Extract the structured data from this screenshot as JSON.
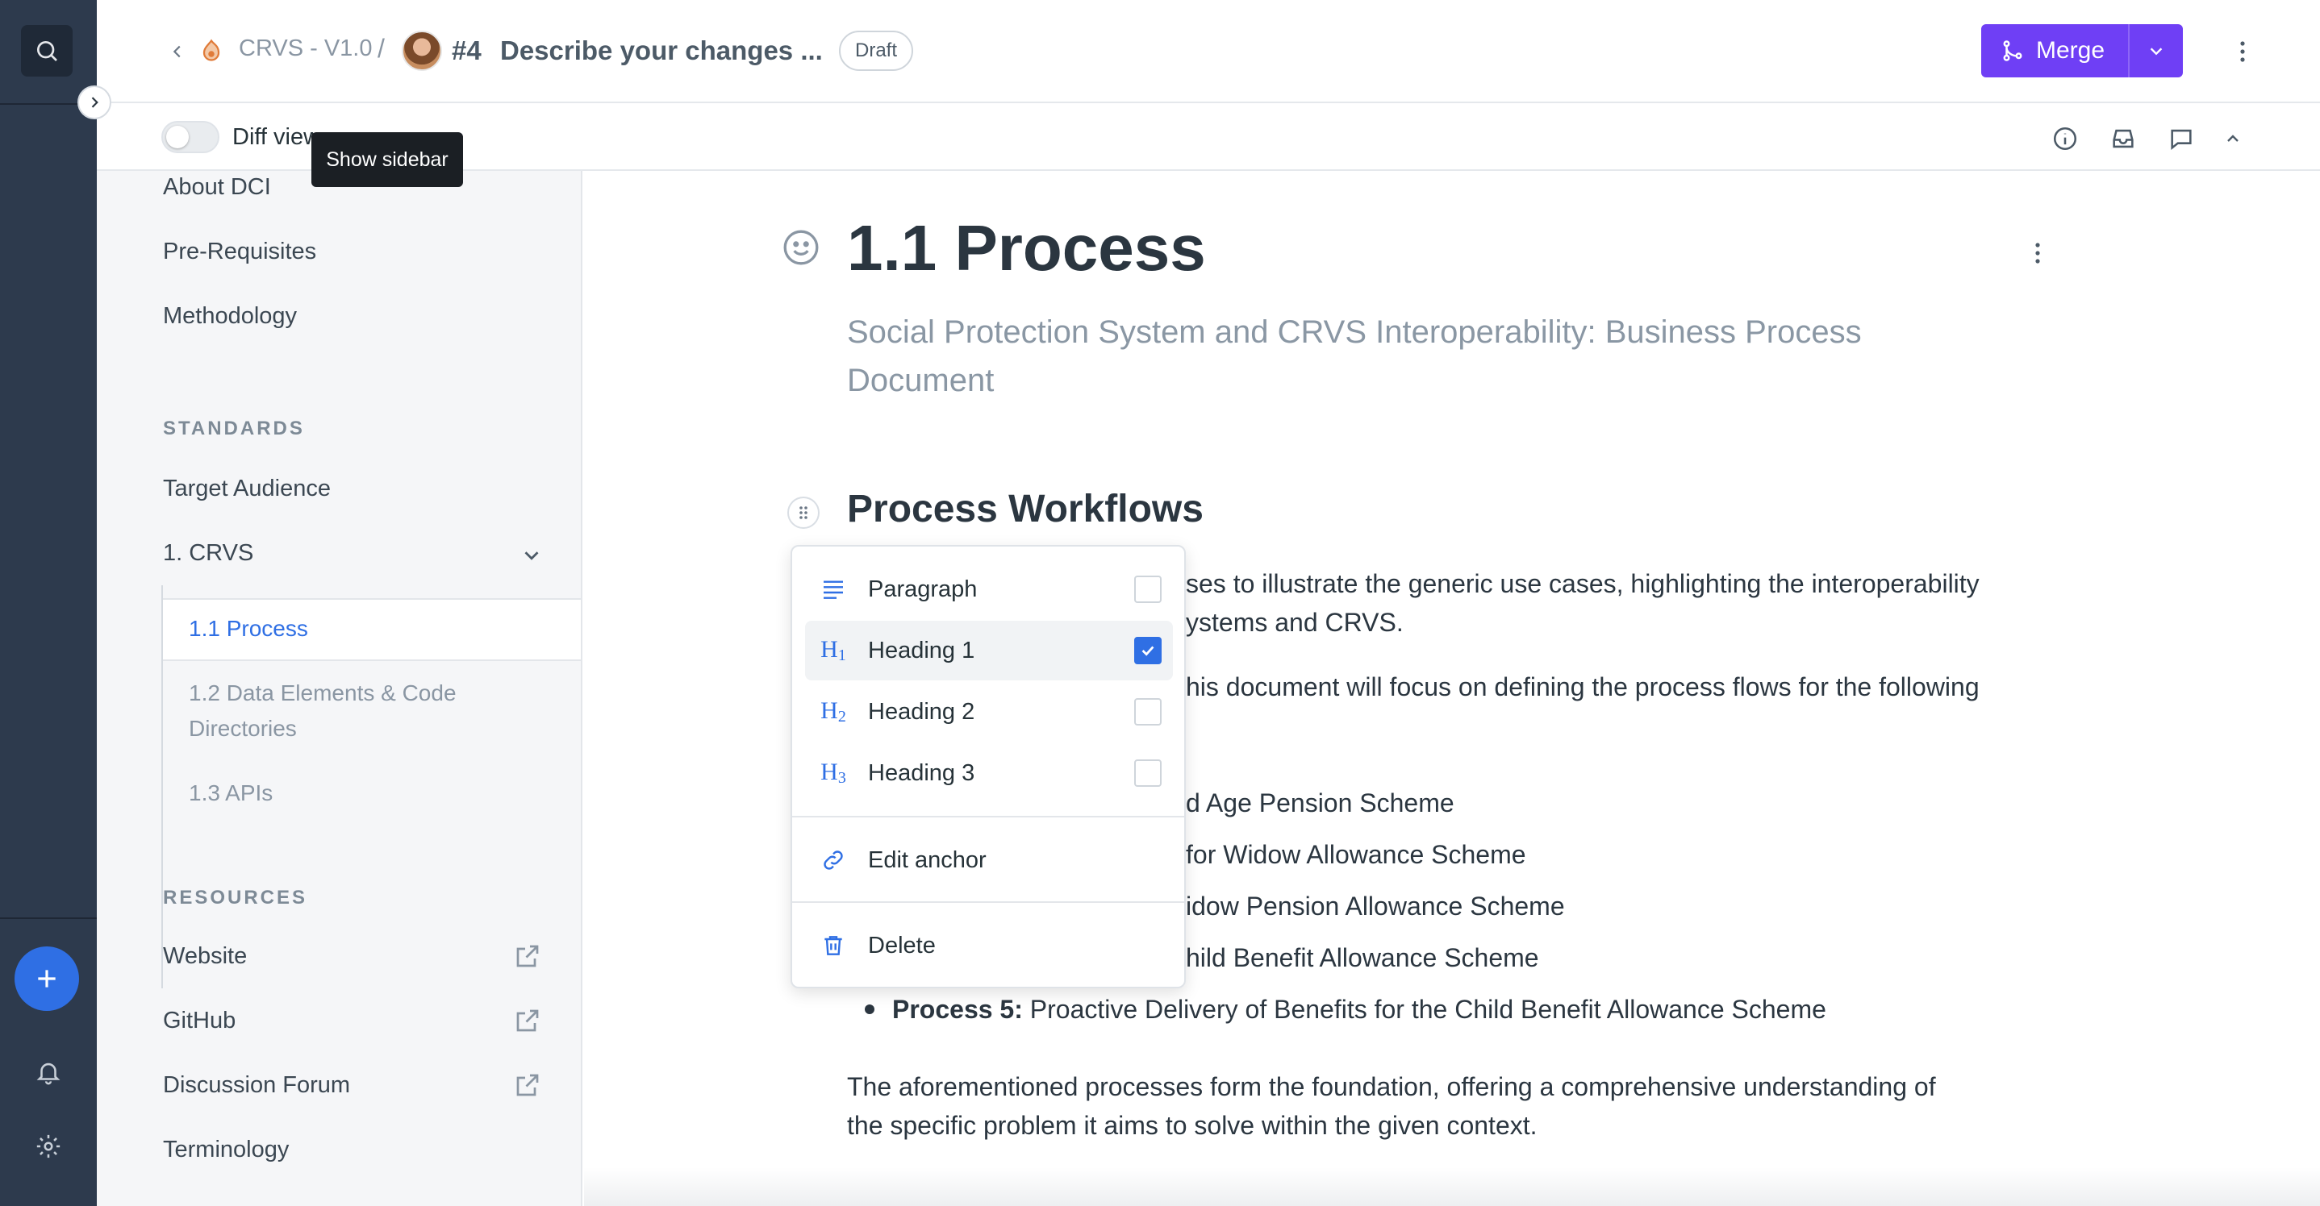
{
  "header": {
    "project": "CRVS - V1.0",
    "separator": "/",
    "change_request_number": "#4",
    "change_request_title": "Describe your changes ...",
    "status_badge": "Draft",
    "merge_label": "Merge",
    "accent_color": "#6f3ff5"
  },
  "toolbar": {
    "diff_view_label": "Diff view",
    "diff_view_enabled": false
  },
  "tooltip": {
    "text": "Show sidebar"
  },
  "sidebar": {
    "top_items": [
      "About DCI",
      "Pre-Requisites",
      "Methodology"
    ],
    "standards_heading": "STANDARDS",
    "standards_items": [
      "Target Audience",
      "1. CRVS"
    ],
    "crvs_children": [
      "1.1 Process",
      "1.2 Data Elements & Code",
      "Directories",
      "1.3 APIs"
    ],
    "resources_heading": "RESOURCES",
    "resources_items": [
      "Website",
      "GitHub",
      "Discussion Forum",
      "Terminology"
    ]
  },
  "document": {
    "title": "1.1 Process",
    "subtitle_line1": "Social Protection System and CRVS Interoperability: Business Process",
    "subtitle_line2": "Document",
    "heading": "Process Workflows",
    "para1_line1": "ses to illustrate the generic use cases, highlighting the interoperability",
    "para1_line2": "ystems and CRVS.",
    "para2_line1": "his document will focus on defining the process flows for the following",
    "list": [
      "d Age Pension Scheme",
      "for Widow Allowance Scheme",
      "idow Pension Allowance Scheme",
      "hild Benefit Allowance Scheme"
    ],
    "process5_label": "Process 5:",
    "process5_text": "Proactive Delivery of Benefits for the Child Benefit Allowance Scheme",
    "closing_line1": "The aforementioned processes form the foundation, offering a comprehensive understanding of",
    "closing_line2": "the specific problem it aims to solve within the given context."
  },
  "block_menu": {
    "items": [
      {
        "label": "Paragraph",
        "icon": "paragraph-icon",
        "checked": false
      },
      {
        "label": "Heading 1",
        "icon": "heading-1-icon",
        "checked": true
      },
      {
        "label": "Heading 2",
        "icon": "heading-2-icon",
        "checked": false
      },
      {
        "label": "Heading 3",
        "icon": "heading-3-icon",
        "checked": false
      }
    ],
    "edit_anchor": "Edit anchor",
    "delete": "Delete",
    "h1_glyph": "H",
    "h1_sub": "1",
    "h2_sub": "2",
    "h3_sub": "3"
  }
}
